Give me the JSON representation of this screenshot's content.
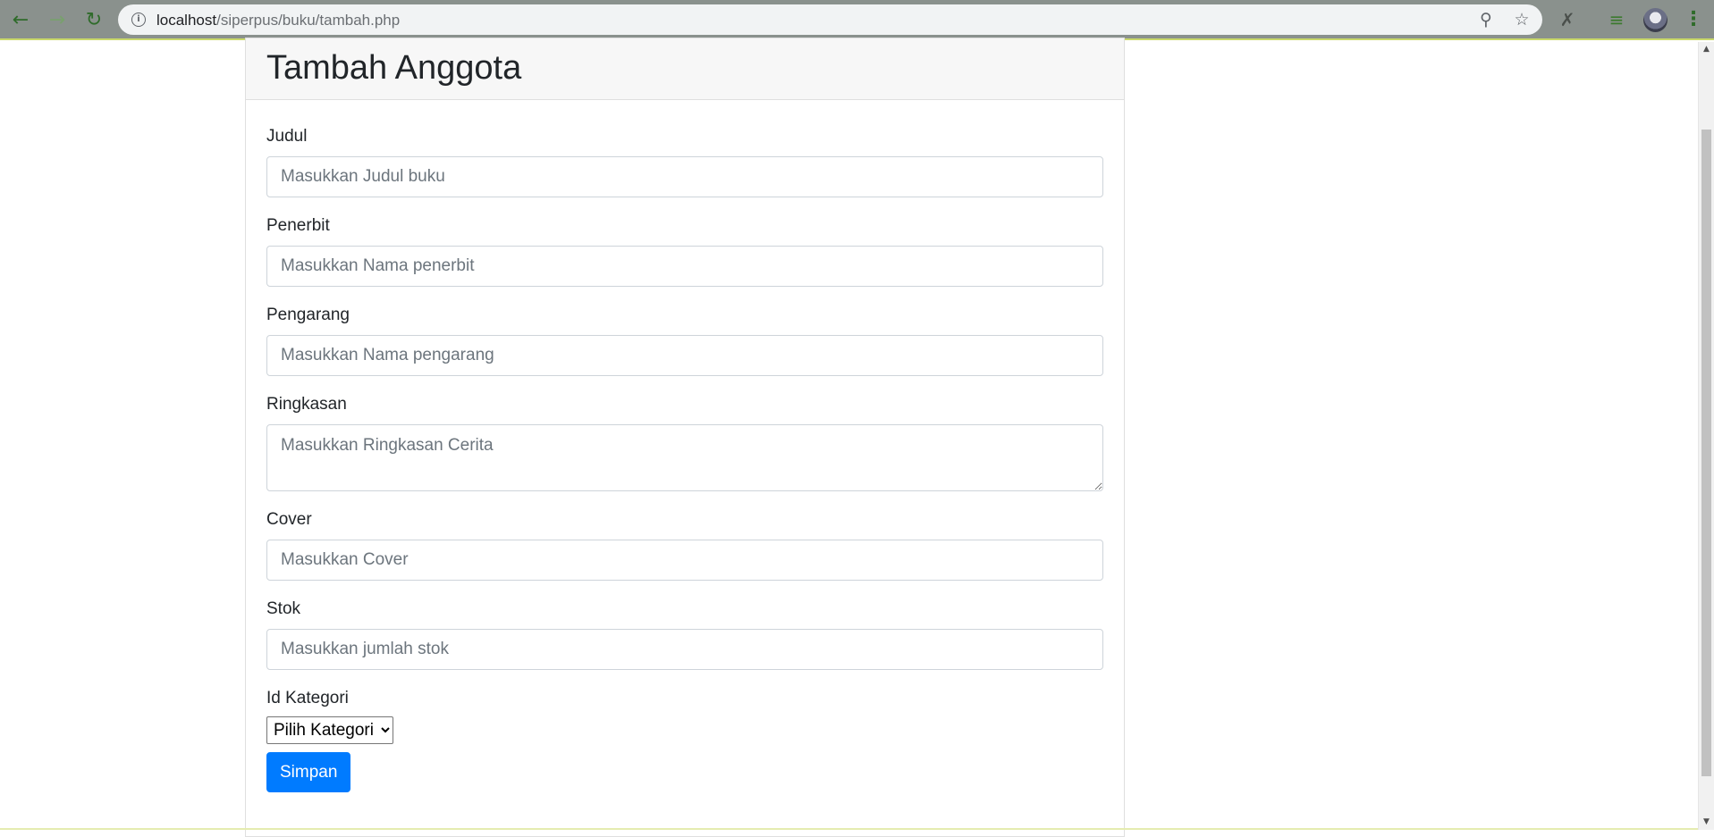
{
  "browser": {
    "url_host": "localhost",
    "url_path": "/siperpus/buku/tambah.php",
    "back_icon": "back-arrow-icon",
    "forward_icon": "forward-arrow-icon",
    "reload_icon": "reload-icon"
  },
  "page": {
    "title": "Tambah Anggota"
  },
  "form": {
    "judul": {
      "label": "Judul",
      "placeholder": "Masukkan Judul buku"
    },
    "penerbit": {
      "label": "Penerbit",
      "placeholder": "Masukkan Nama penerbit"
    },
    "pengarang": {
      "label": "Pengarang",
      "placeholder": "Masukkan Nama pengarang"
    },
    "ringkasan": {
      "label": "Ringkasan",
      "placeholder": "Masukkan Ringkasan Cerita"
    },
    "cover": {
      "label": "Cover",
      "placeholder": "Masukkan Cover"
    },
    "stok": {
      "label": "Stok",
      "placeholder": "Masukkan jumlah stok"
    },
    "kategori": {
      "label": "Id Kategori",
      "selected": "Pilih Kategori"
    },
    "submit_label": "Simpan"
  },
  "colors": {
    "primary": "#007bff",
    "chrome": "#8a918d"
  }
}
